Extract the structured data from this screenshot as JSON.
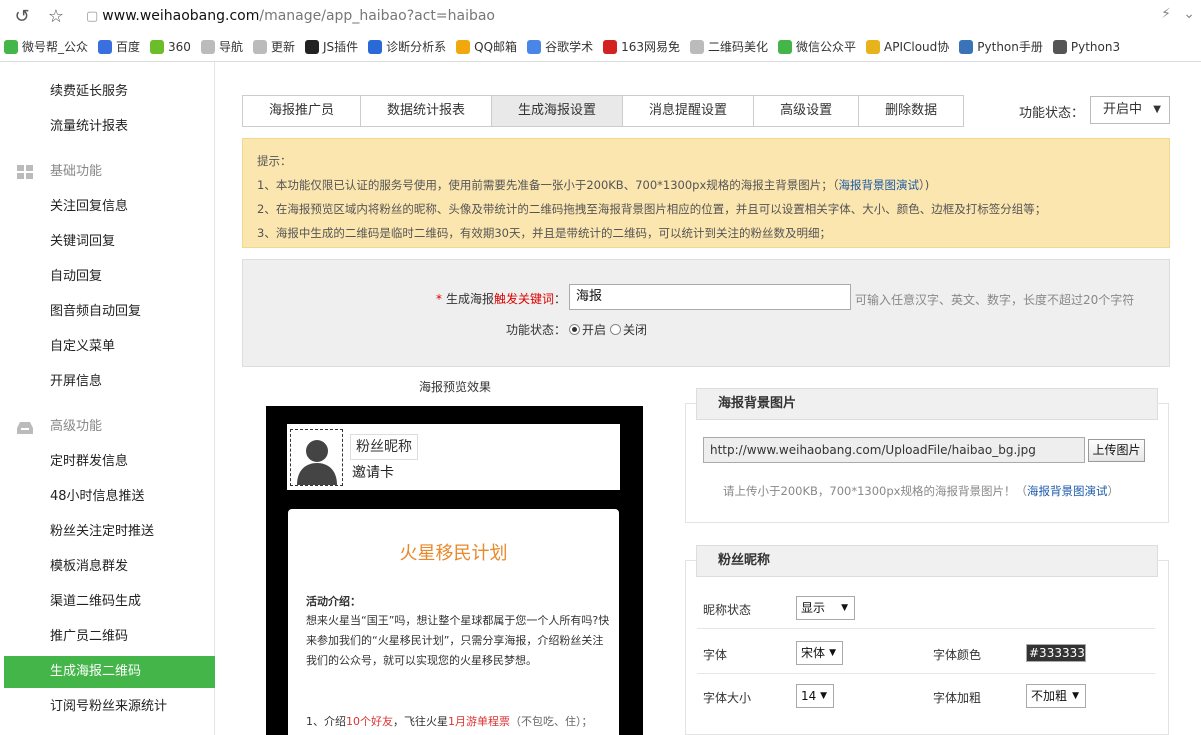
{
  "browser": {
    "url_host": "www.weihaobang.com",
    "url_path": "/manage/app_haibao?act=haibao"
  },
  "bookmarks": [
    {
      "label": "微号帮_公众",
      "color": "#44b549"
    },
    {
      "label": "百度",
      "color": "#3a6fe0"
    },
    {
      "label": "360",
      "color": "#6bbe2a"
    },
    {
      "label": "导航",
      "color": "#bbbbbb"
    },
    {
      "label": "更新",
      "color": "#bbbbbb"
    },
    {
      "label": "JS插件",
      "color": "#222222"
    },
    {
      "label": "诊断分析系",
      "color": "#2a6ad8"
    },
    {
      "label": "QQ邮箱",
      "color": "#f1a80e"
    },
    {
      "label": "谷歌学术",
      "color": "#4a86e8"
    },
    {
      "label": "163网易免",
      "color": "#d22222"
    },
    {
      "label": "二维码美化",
      "color": "#bbbbbb"
    },
    {
      "label": "微信公众平",
      "color": "#44b549"
    },
    {
      "label": "APICloud协",
      "color": "#e8b21c"
    },
    {
      "label": "Python手册",
      "color": "#3a73b8"
    },
    {
      "label": "Python3",
      "color": "#555555"
    }
  ],
  "sidebar": {
    "items_top": [
      "续费延长服务",
      "流量统计报表"
    ],
    "group_basic": "基础功能",
    "items_basic": [
      "关注回复信息",
      "关键词回复",
      "自动回复",
      "图音频自动回复",
      "自定义菜单",
      "开屏信息"
    ],
    "group_advanced": "高级功能",
    "items_advanced": [
      "定时群发信息",
      "48小时信息推送",
      "粉丝关注定时推送",
      "模板消息群发",
      "渠道二维码生成",
      "推广员二维码",
      "生成海报二维码",
      "订阅号粉丝来源统计"
    ],
    "active": "生成海报二维码"
  },
  "tabs": [
    {
      "label": "海报推广员",
      "active": false
    },
    {
      "label": "数据统计报表",
      "active": false
    },
    {
      "label": "生成海报设置",
      "active": true
    },
    {
      "label": "消息提醒设置",
      "active": false
    },
    {
      "label": "高级设置",
      "active": false
    },
    {
      "label": "删除数据",
      "active": false
    }
  ],
  "status": {
    "label": "功能状态：",
    "value": "开启中"
  },
  "tip": {
    "title": "提示：",
    "line1_a": "1、本功能仅限已认证的服务号使用，使用前需要先准备一张小于200KB、700*1300px规格的海报主背景图片；（",
    "line1_link": "海报背景图演试",
    "line1_b": "）)",
    "line2": "2、在海报预览区域内将粉丝的昵称、头像及带统计的二维码拖拽至海报背景图片相应的位置，并且可以设置相关字体、大小、颜色、边框及打标签分组等；",
    "line3": "3、海报中生成的二维码是临时二维码，有效期30天，并且是带统计的二维码，可以统计到关注的粉丝数及明细；"
  },
  "form": {
    "kw_label_a": "生成海报",
    "kw_label_hl": "触发关键词",
    "kw_label_b": "：",
    "kw_value": "海报",
    "kw_hint": "可输入任意汉字、英文、数字，长度不超过20个字符",
    "status_label": "功能状态：",
    "opt_on": "开启",
    "opt_off": "关闭"
  },
  "preview": {
    "title": "海报预览效果",
    "nickname": "粉丝昵称",
    "invite": "邀请卡",
    "card_title": "火星移民计划",
    "card_sub": "活动介绍：",
    "card_body": "想来火星当“国王”吗，想让整个星球都属于您一个人所有吗?快来参加我们的“火星移民计划”，只需分享海报，介绍粉丝关注我们的公众号，就可以实现您的火星移民梦想。",
    "step_a": "1、介绍",
    "step_red1": "10个好友",
    "step_b": "，飞往火星",
    "step_red2": "1月游单程票",
    "step_c": "（不包吃、住）；"
  },
  "bg_panel": {
    "title": "海报背景图片",
    "url": "http://www.weihaobang.com/UploadFile/haibao_bg.jpg",
    "upload": "上传图片",
    "hint_a": "请上传小于200KB，700*1300px规格的海报背景图片！（",
    "hint_link": "海报背景图演试",
    "hint_b": "）"
  },
  "nick_panel": {
    "title": "粉丝昵称",
    "nick_status_label": "昵称状态",
    "nick_status": "显示",
    "font_label": "字体",
    "font": "宋体",
    "color_label": "字体颜色",
    "color": "#333333",
    "size_label": "字体大小",
    "size": "14",
    "bold_label": "字体加粗",
    "bold": "不加粗"
  }
}
